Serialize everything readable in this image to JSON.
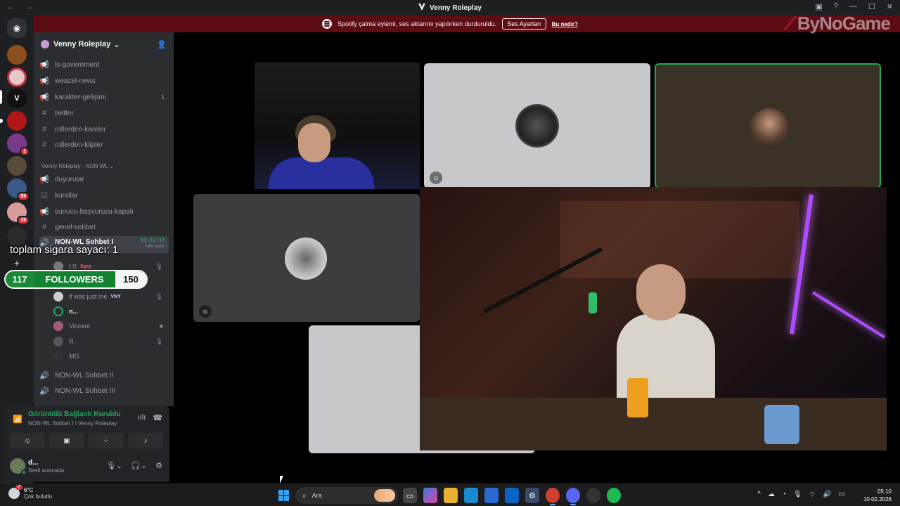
{
  "window": {
    "title": "Venny Roleplay",
    "nav": "← →",
    "controls": [
      "▣",
      "?",
      "—",
      "☐",
      "✕"
    ]
  },
  "notice": {
    "text": "Spotify çalma eylemi, ses aktarımı yapılırken durduruldu.",
    "button": "Ses Ayarları",
    "link": "Bu nedir?"
  },
  "watermark": "ByNoGame",
  "rail": {
    "badges": [
      "1",
      "69",
      "19"
    ]
  },
  "server": {
    "name": "Venny Roleplay",
    "chevron": "⌄",
    "invite_icon": "person-add-icon"
  },
  "channels_top": [
    {
      "icon": "📢",
      "name": "ls-government"
    },
    {
      "icon": "📢",
      "name": "weazel-news"
    },
    {
      "icon": "📢",
      "name": "karakter-gelişimi",
      "count": "1"
    },
    {
      "icon": "#",
      "name": "twitter"
    },
    {
      "icon": "#",
      "name": "rollerden-kareler"
    },
    {
      "icon": "#",
      "name": "rollerden-klipler"
    }
  ],
  "category_nonwl": "Venny Roleplay - NON WL",
  "channels_nonwl": [
    {
      "icon": "📢",
      "name": "duyurular"
    },
    {
      "icon": "☑",
      "name": "kurallar"
    },
    {
      "icon": "📢",
      "name": "sunucu-başvurusu-kapalı"
    },
    {
      "icon": "#",
      "name": "genel-sohbet"
    }
  ],
  "active_voice": {
    "name": "NON-WL Sohbet I",
    "timer": "01:31:17",
    "sub": "NAL bizce"
  },
  "voice_users": [
    {
      "name": "I S",
      "tag": "Sgrp",
      "status": "🎙"
    },
    {
      "name": "if was just me",
      "tag": "VNY",
      "status": "🎙"
    },
    {
      "name": "n...",
      "tag": "",
      "status": ""
    },
    {
      "name": "Vincent",
      "tag": "",
      "status": "■"
    },
    {
      "name": "R.",
      "tag": "",
      "status": "🎙"
    },
    {
      "name": "MG",
      "tag": "",
      "status": ""
    }
  ],
  "channels_after": [
    {
      "icon": "🔊",
      "name": "NON-WL Sohbet II"
    },
    {
      "icon": "🔊",
      "name": "NON-WL Sohbet III"
    }
  ],
  "overlay": {
    "counter_label": "toplam sigara sayacı:",
    "counter_value": "1",
    "followers_current": "117",
    "followers_label": "FOLLOWERS",
    "followers_goal": "150"
  },
  "voice_panel": {
    "status": "Görüntülü Bağlantı Kuruldu",
    "sub": "NON-WL Sohbet I / Venny Roleplay",
    "buttons": [
      "⦸",
      "▣",
      "⁘",
      "♪"
    ]
  },
  "user_panel": {
    "name": "d...",
    "status": "Sesli aramada"
  },
  "taskbar": {
    "weather_badge": "7",
    "temp": "6°C",
    "weather_desc": "Çok bulutlu",
    "search_placeholder": "Ara",
    "time": "05:10",
    "date": "10.02.2026"
  }
}
